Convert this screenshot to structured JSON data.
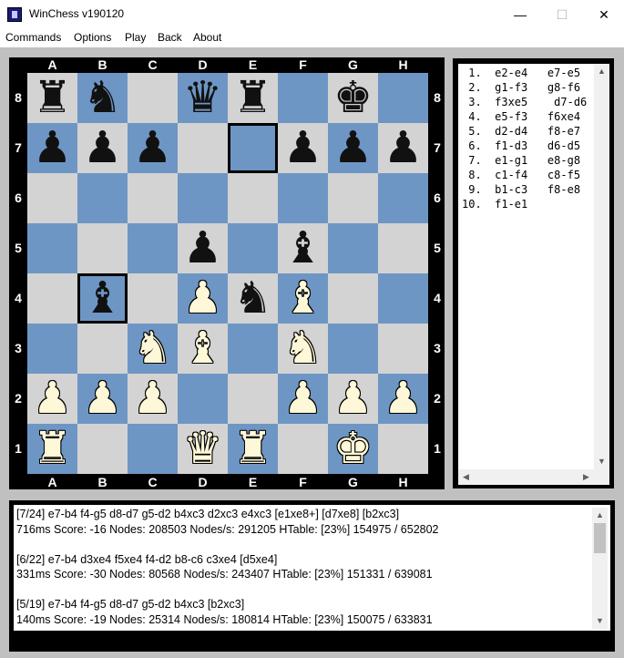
{
  "window": {
    "title": "WinChess v190120",
    "controls": [
      "—",
      "☐",
      "✕"
    ]
  },
  "menu": [
    "Commands",
    "Options",
    "Play",
    "Back",
    "About"
  ],
  "board": {
    "files": [
      "A",
      "B",
      "C",
      "D",
      "E",
      "F",
      "G",
      "H"
    ],
    "ranks": [
      "8",
      "7",
      "6",
      "5",
      "4",
      "3",
      "2",
      "1"
    ],
    "position": [
      [
        "bR",
        "bN",
        "",
        "bQ",
        "bR",
        "",
        "bK",
        ""
      ],
      [
        "bP",
        "bP",
        "bP",
        "",
        "",
        "bP",
        "bP",
        "bP"
      ],
      [
        "",
        "",
        "",
        "",
        "",
        "",
        "",
        ""
      ],
      [
        "",
        "",
        "",
        "bP",
        "",
        "bB",
        "",
        ""
      ],
      [
        "",
        "bB",
        "",
        "wP",
        "bN",
        "wB",
        "",
        ""
      ],
      [
        "",
        "",
        "wN",
        "wB",
        "",
        "wN",
        "",
        ""
      ],
      [
        "wP",
        "wP",
        "wP",
        "",
        "",
        "wP",
        "wP",
        "wP"
      ],
      [
        "wR",
        "",
        "",
        "wQ",
        "wR",
        "",
        "wK",
        ""
      ]
    ],
    "highlighted": [
      "e7",
      "b4"
    ],
    "colors": {
      "light": "#d3d3d3",
      "dark": "#6e96c4",
      "frame": "#000000"
    }
  },
  "moves": [
    {
      "n": " 1.",
      "w": "e2-e4",
      "b": "e7-e5"
    },
    {
      "n": " 2.",
      "w": "g1-f3",
      "b": "g8-f6"
    },
    {
      "n": " 3.",
      "w": "f3xe5",
      "b": " d7-d6"
    },
    {
      "n": " 4.",
      "w": "e5-f3",
      "b": "f6xe4"
    },
    {
      "n": " 5.",
      "w": "d2-d4",
      "b": "f8-e7"
    },
    {
      "n": " 6.",
      "w": "f1-d3",
      "b": "d6-d5"
    },
    {
      "n": " 7.",
      "w": "e1-g1",
      "b": "e8-g8"
    },
    {
      "n": " 8.",
      "w": "c1-f4",
      "b": "c8-f5"
    },
    {
      "n": " 9.",
      "w": "b1-c3",
      "b": "f8-e8"
    },
    {
      "n": "10.",
      "w": "f1-e1",
      "b": ""
    }
  ],
  "log": [
    "[7/24] e7-b4 f4-g5 d8-d7 g5-d2 b4xc3 d2xc3 e4xc3 [e1xe8+] [d7xe8] [b2xc3]",
    "716ms Score: -16 Nodes: 208503 Nodes/s: 291205 HTable: [23%] 154975 / 652802",
    "",
    "[6/22] e7-b4 d3xe4 f5xe4 f4-d2 b8-c6 c3xe4 [d5xe4]",
    "331ms Score: -30 Nodes: 80568 Nodes/s: 243407 HTable: [23%] 151331 / 639081",
    "",
    "[5/19] e7-b4 f4-g5 d8-d7 g5-d2 b4xc3 [b2xc3]",
    "140ms Score: -19 Nodes: 25314 Nodes/s: 180814 HTable: [23%] 150075 / 633831"
  ]
}
